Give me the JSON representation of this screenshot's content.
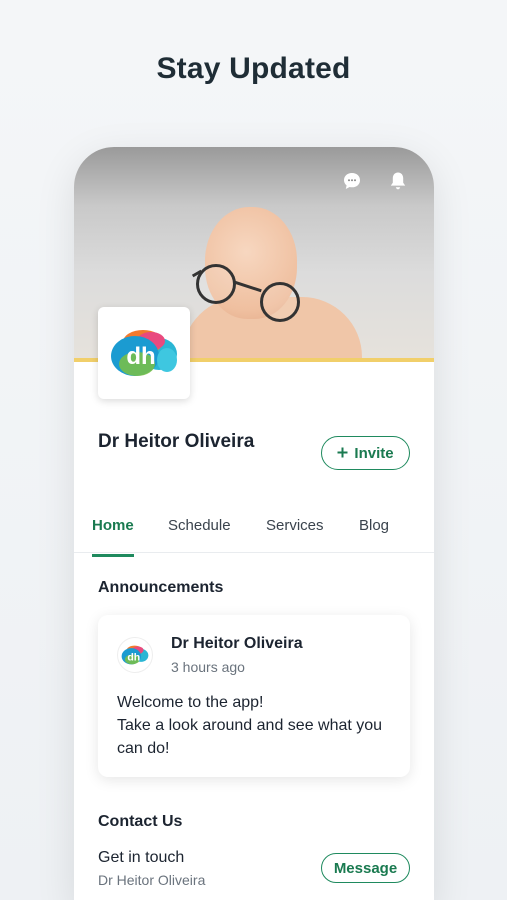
{
  "headline": "Stay Updated",
  "colors": {
    "accent": "#1f8a5e",
    "cover_border": "#f1cf6a"
  },
  "header_icons": [
    "chat-icon",
    "bell-icon"
  ],
  "profile": {
    "name": "Dr Heitor Oliveira",
    "logo_text": "dh",
    "invite_label": "Invite"
  },
  "tabs": [
    {
      "label": "Home",
      "active": true
    },
    {
      "label": "Schedule",
      "active": false
    },
    {
      "label": "Services",
      "active": false
    },
    {
      "label": "Blog",
      "active": false
    }
  ],
  "announcements": {
    "title": "Announcements",
    "post": {
      "author": "Dr Heitor Oliveira",
      "time": "3 hours ago",
      "line1": "Welcome to the app!",
      "line2": "Take a look around and see what you can do!"
    }
  },
  "contact": {
    "title": "Contact Us",
    "subtitle": "Get in touch",
    "name": "Dr Heitor Oliveira",
    "message_label": "Message"
  }
}
